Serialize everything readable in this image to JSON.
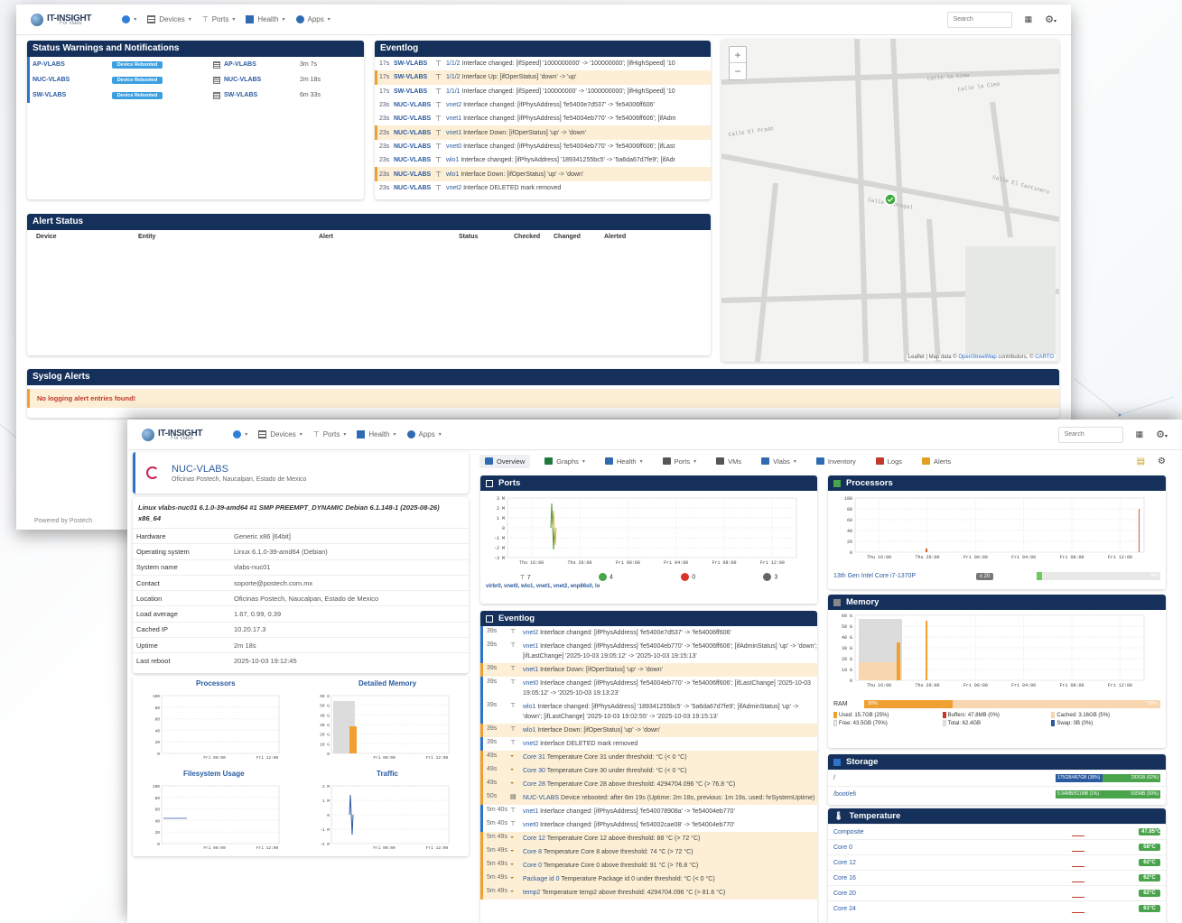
{
  "brand": {
    "name": "IT-INSIGHT",
    "sub": "For vlabs"
  },
  "nav": {
    "devices": "Devices",
    "ports": "Ports",
    "health": "Health",
    "apps": "Apps",
    "search_placeholder": "Search"
  },
  "win1": {
    "status_warnings": {
      "title": "Status Warnings and Notifications",
      "rows": [
        {
          "device": "AP-VLABS",
          "badge": "Device Rebooted",
          "entity": "AP-VLABS",
          "time": "3m 7s"
        },
        {
          "device": "NUC-VLABS",
          "badge": "Device Rebooted",
          "entity": "NUC-VLABS",
          "time": "2m 18s"
        },
        {
          "device": "SW-VLABS",
          "badge": "Device Rebooted",
          "entity": "SW-VLABS",
          "time": "6m 33s"
        }
      ]
    },
    "eventlog": {
      "title": "Eventlog",
      "rows": [
        {
          "t": "17s",
          "dev": "SW-VLABS",
          "port": "1/1/2",
          "msg": "Interface changed: [ifSpeed] '1000000000' -> '100000000'; [ifHighSpeed] '10",
          "hl": false
        },
        {
          "t": "17s",
          "dev": "SW-VLABS",
          "port": "1/1/2",
          "msg": "Interface Up: [ifOperStatus] 'down' -> 'up'",
          "hl": true
        },
        {
          "t": "17s",
          "dev": "SW-VLABS",
          "port": "1/1/1",
          "msg": "Interface changed: [ifSpeed] '100000000' -> '1000000000'; [ifHighSpeed] '10",
          "hl": false
        },
        {
          "t": "23s",
          "dev": "NUC-VLABS",
          "port": "vnet2",
          "msg": "Interface changed: [ifPhysAddress] 'fe5400e7d537' -> 'fe54006ff606'",
          "hl": false
        },
        {
          "t": "23s",
          "dev": "NUC-VLABS",
          "port": "vnet1",
          "msg": "Interface changed: [ifPhysAddress] 'fe54004eb770' -> 'fe54006ff606'; [ifAdm",
          "hl": false
        },
        {
          "t": "23s",
          "dev": "NUC-VLABS",
          "port": "vnet1",
          "msg": "Interface Down: [ifOperStatus] 'up' -> 'down'",
          "hl": true
        },
        {
          "t": "23s",
          "dev": "NUC-VLABS",
          "port": "vnet0",
          "msg": "Interface changed: [ifPhysAddress] 'fe54004eb770' -> 'fe54006ff606'; [ifLast",
          "hl": false
        },
        {
          "t": "23s",
          "dev": "NUC-VLABS",
          "port": "wlo1",
          "msg": "Interface changed: [ifPhysAddress] '189341255bc5' -> '5a6da67d7fe9'; [ifAdr",
          "hl": false
        },
        {
          "t": "23s",
          "dev": "NUC-VLABS",
          "port": "wlo1",
          "msg": "Interface Down: [ifOperStatus] 'up' -> 'down'",
          "hl": true
        },
        {
          "t": "23s",
          "dev": "NUC-VLABS",
          "port": "vnet2",
          "msg": "Interface DELETED mark removed",
          "hl": false
        }
      ]
    },
    "alert_status": {
      "title": "Alert Status",
      "columns": [
        "Device",
        "Entity",
        "Alert",
        "Status",
        "Checked",
        "Changed",
        "Alerted"
      ]
    },
    "map": {
      "zoom_in": "+",
      "zoom_out": "−",
      "attribution_prefix": "Leaflet | Map data ©",
      "attribution_osm": "OpenStreetMap",
      "attribution_mid": "contributors, ©",
      "attribution_carto": "CARTO",
      "streets": [
        "Calle la Cima",
        "Calle la Cima",
        "Calle El Prado",
        "Calle El Cantinero",
        "Calle Pedregal"
      ]
    },
    "syslog": {
      "title": "Syslog Alerts",
      "message": "No logging alert entries found!"
    },
    "footer": "Powered by Postech"
  },
  "win2": {
    "device": {
      "name": "NUC-VLABS",
      "location": "Oficinas Postech, Naucalpan, Estado de Mexico"
    },
    "uname": "Linux vlabs-nuc01 6.1.0-39-amd64 #1 SMP PREEMPT_DYNAMIC Debian 6.1.148-1 (2025-08-26) x86_64",
    "info": [
      {
        "k": "Hardware",
        "v": "Generic x86 [64bit]"
      },
      {
        "k": "Operating system",
        "v": "Linux 6.1.0-39-amd64 (Debian)"
      },
      {
        "k": "System name",
        "v": "vlabs-nuc01"
      },
      {
        "k": "Contact",
        "v": "soporte@postech.com.mx"
      },
      {
        "k": "Location",
        "v": "Oficinas Postech, Naucalpan, Estado de Mexico"
      },
      {
        "k": "Load average",
        "v": "1.67, 0.99, 0.39"
      },
      {
        "k": "Cached IP",
        "v": "10.20.17.3"
      },
      {
        "k": "Uptime",
        "v": "2m 18s"
      },
      {
        "k": "Last reboot",
        "v": "2025-10-03 19:12:45"
      }
    ],
    "mini_graphs": {
      "processors": "Processors",
      "memory": "Detailed Memory",
      "filesystem": "Filesystem Usage",
      "traffic": "Traffic",
      "proc_y": [
        "100",
        "80",
        "60",
        "40",
        "20",
        "0"
      ],
      "mem_y": [
        "60 G",
        "50 G",
        "40 G",
        "30 G",
        "20 G",
        "10 G",
        "0"
      ],
      "fs_y": [
        "100",
        "80",
        "60",
        "40",
        "20",
        "0"
      ],
      "traffic_y": [
        "2 M",
        "1 M",
        "0",
        "-1 M",
        "-2 M"
      ],
      "x": [
        "Fri 00:00",
        "Fri 12:00"
      ]
    },
    "tabs": [
      "Overview",
      "Graphs",
      "Health",
      "Ports",
      "VMs",
      "Vlabs",
      "Inventory",
      "Logs",
      "Alerts"
    ],
    "ports": {
      "title": "Ports",
      "y": [
        "3 M",
        "2 M",
        "1 M",
        "0",
        "-1 M",
        "-2 M",
        "-3 M"
      ],
      "x": [
        "Thu 16:00",
        "Thu 20:00",
        "Fri 00:00",
        "Fri 04:00",
        "Fri 08:00",
        "Fri 12:00"
      ],
      "total": "7",
      "up": "4",
      "down": "0",
      "other": "3",
      "list": "virbr0, vnet0, wlo1, vnet1, vnet2, enp86s0, lo"
    },
    "eventlog": {
      "title": "Eventlog",
      "rows": [
        {
          "t": "39s",
          "icon": "port",
          "obj": "vnet2",
          "msg": "Interface changed: [ifPhysAddress] 'fe5400e7d537' -> 'fe54006ff606'",
          "hl": false
        },
        {
          "t": "39s",
          "icon": "port",
          "obj": "vnet1",
          "msg": "Interface changed: [ifPhysAddress] 'fe54004eb770' -> 'fe54006ff606'; [ifAdminStatus] 'up' -> 'down'; [ifLastChange] '2025-10-03 19:05:12' -> '2025-10-03 19:15:13'",
          "hl": false
        },
        {
          "t": "39s",
          "icon": "port",
          "obj": "vnet1",
          "msg": "Interface Down: [ifOperStatus] 'up' -> 'down'",
          "hl": true
        },
        {
          "t": "39s",
          "icon": "port",
          "obj": "vnet0",
          "msg": "Interface changed: [ifPhysAddress] 'fe54004eb770' -> 'fe54006ff606'; [ifLastChange] '2025-10-03 19:05:12' -> '2025-10-03 19:13:23'",
          "hl": false
        },
        {
          "t": "39s",
          "icon": "port",
          "obj": "wlo1",
          "msg": "Interface changed: [ifPhysAddress] '189341255bc5' -> '5a6da67d7fe9'; [ifAdminStatus] 'up' -> 'down'; [ifLastChange] '2025-10-03 19:02:55' -> '2025-10-03 19:15:13'",
          "hl": false
        },
        {
          "t": "39s",
          "icon": "port",
          "obj": "wlo1",
          "msg": "Interface Down: [ifOperStatus] 'up' -> 'down'",
          "hl": true
        },
        {
          "t": "39s",
          "icon": "port",
          "obj": "vnet2",
          "msg": "Interface DELETED mark removed",
          "hl": false
        },
        {
          "t": "49s",
          "icon": "temp",
          "obj": "Core 31",
          "msg": "Temperature Core 31 under threshold: °C (< 0 °C)",
          "hl": true
        },
        {
          "t": "49s",
          "icon": "temp",
          "obj": "Core 30",
          "msg": "Temperature Core 30 under threshold: °C (< 0 °C)",
          "hl": true
        },
        {
          "t": "49s",
          "icon": "temp",
          "obj": "Core 28",
          "msg": "Temperature Core 28 above threshold: 4294704.096 °C (> 76.8 °C)",
          "hl": true
        },
        {
          "t": "50s",
          "icon": "dev",
          "obj": "NUC-VLABS",
          "msg": "Device rebooted: after 6m 19s (Uptime: 2m 18s, previous: 1m 19s, used: hrSystemUptime)",
          "hl": true
        },
        {
          "t": "5m 40s",
          "icon": "port",
          "obj": "vnet1",
          "msg": "Interface changed: [ifPhysAddress] 'fe540078908a' -> 'fe54004eb770'",
          "hl": false
        },
        {
          "t": "5m 40s",
          "icon": "port",
          "obj": "vnet0",
          "msg": "Interface changed: [ifPhysAddress] 'fe54002cae08' -> 'fe54004eb770'",
          "hl": false
        },
        {
          "t": "5m 49s",
          "icon": "temp",
          "obj": "Core 12",
          "msg": "Temperature Core 12 above threshold: 88 °C (> 72 °C)",
          "hl": true
        },
        {
          "t": "5m 49s",
          "icon": "temp",
          "obj": "Core 8",
          "msg": "Temperature Core 8 above threshold: 74 °C (> 72 °C)",
          "hl": true
        },
        {
          "t": "5m 49s",
          "icon": "temp",
          "obj": "Core 0",
          "msg": "Temperature Core 0 above threshold: 91 °C (> 76.8 °C)",
          "hl": true
        },
        {
          "t": "5m 49s",
          "icon": "temp",
          "obj": "Package id 0",
          "msg": "Temperature Package id 0 under threshold: °C (< 0 °C)",
          "hl": true
        },
        {
          "t": "5m 49s",
          "icon": "temp",
          "obj": "temp2",
          "msg": "Temperature temp2 above threshold: 4294704.096 °C (> 81.6 °C)",
          "hl": true
        }
      ]
    },
    "processors": {
      "title": "Processors",
      "y": [
        "100",
        "80",
        "60",
        "40",
        "20",
        "0"
      ],
      "x": [
        "Thu 16:00",
        "Thu 20:00",
        "Fri 00:00",
        "Fri 04:00",
        "Fri 08:00",
        "Fri 12:00"
      ],
      "cpu": "13th Gen Intel Core i7-1370P",
      "count": "x 20",
      "pct": "4%",
      "pct_value": 4
    },
    "memory": {
      "title": "Memory",
      "y": [
        "60 G",
        "50 G",
        "40 G",
        "30 G",
        "20 G",
        "10 G",
        "0"
      ],
      "x": [
        "Thu 16:00",
        "Thu 20:00",
        "Fri 00:00",
        "Fri 04:00",
        "Fri 08:00",
        "Fri 12:00"
      ],
      "ram_label": "RAM",
      "used_pct": "30%",
      "total_pct": "70%",
      "used_value": 30,
      "used": "Used: 15.7GB (25%)",
      "buffers": "Buffers: 47.8MB (0%)",
      "cached": "Cached: 3.16GB (5%)",
      "free": "Free: 43.5GB (70%)",
      "total": "Total: 62.4GB",
      "swap": "Swap: 0B (0%)"
    },
    "storage": {
      "title": "Storage",
      "rows": [
        {
          "name": "/",
          "used": "175GB/467GB (38%)",
          "free": "292GB (62%)",
          "pct": 38
        },
        {
          "name": "/boot/efi",
          "used": "5.94MB/511MB (1%)",
          "free": "505MB (99%)",
          "pct": 1
        }
      ]
    },
    "temperature": {
      "title": "Temperature",
      "rows": [
        {
          "name": "Composite",
          "val": "47.85°C"
        },
        {
          "name": "Core 0",
          "val": "58°C"
        },
        {
          "name": "Core 12",
          "val": "62°C"
        },
        {
          "name": "Core 16",
          "val": "62°C"
        },
        {
          "name": "Core 20",
          "val": "62°C"
        },
        {
          "name": "Core 24",
          "val": "61°C"
        }
      ]
    }
  },
  "colors": {
    "navy": "#15305a",
    "accent": "#2d74c8",
    "warn": "#f0a030",
    "ok": "#49a44b"
  }
}
